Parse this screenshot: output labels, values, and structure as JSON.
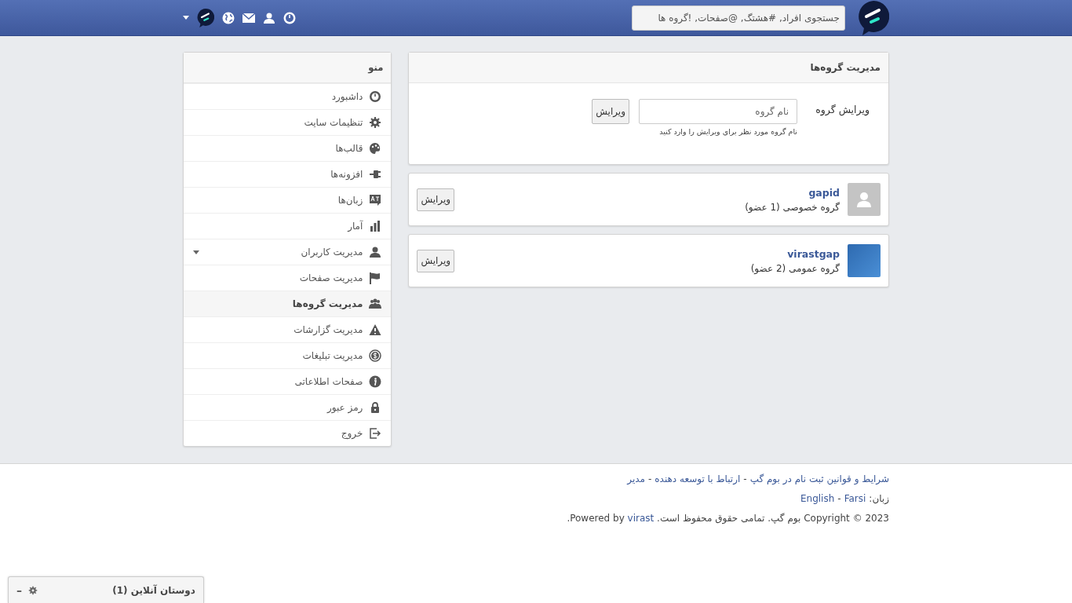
{
  "header": {
    "search": {
      "placeholder": "جستجوی افراد, #هشتگ, @صفحات, !گروه ها"
    }
  },
  "panel": {
    "title": "مدیریت گروه‌ها",
    "form": {
      "label": "ویرایش گروه",
      "placeholder": "نام گروه",
      "button": "ویرایش",
      "help": "نام گروه مورد نظر برای ویرایش را وارد کنید"
    }
  },
  "groups": [
    {
      "name": "gapid",
      "info": "گروه خصوصی (1 عضو)",
      "kind": "default-avatar",
      "button": "ویرایش"
    },
    {
      "name": "virastgap",
      "info": "گروه عمومی (2 عضو)",
      "kind": "photo",
      "button": "ویرایش"
    }
  ],
  "menu": {
    "title": "منو",
    "items": [
      {
        "label": "داشبورد",
        "kind": "link",
        "selected": false
      },
      {
        "label": "تنظیمات سایت",
        "kind": "link",
        "selected": false
      },
      {
        "label": "قالب‌ها",
        "kind": "link",
        "selected": false
      },
      {
        "label": "افزونه‌ها",
        "kind": "link",
        "selected": false
      },
      {
        "label": "زبان‌ها",
        "kind": "link",
        "selected": false
      },
      {
        "label": "آمار",
        "kind": "link",
        "selected": false
      },
      {
        "label": "مدیریت کاربران",
        "kind": "dropdown",
        "selected": false
      },
      {
        "label": "مدیریت صفحات",
        "kind": "link",
        "selected": false
      },
      {
        "label": "مدیریت گروه‌ها",
        "kind": "link",
        "selected": true
      },
      {
        "label": "مدیریت گزارشات",
        "kind": "link",
        "selected": false
      },
      {
        "label": "مدیریت تبلیغات",
        "kind": "link",
        "selected": false
      },
      {
        "label": "صفحات اطلاعاتی",
        "kind": "link",
        "selected": false
      },
      {
        "label": "رمز عبور",
        "kind": "link",
        "selected": false
      },
      {
        "label": "خروج",
        "kind": "link",
        "selected": false
      }
    ]
  },
  "footer": {
    "links": [
      "شرایط و قوانین ثبت نام در بوم گپ",
      "ارتباط با توسعه دهنده",
      "مدیر"
    ],
    "separator": "-",
    "language_label": "زبان:",
    "languages": [
      "Farsi",
      "English"
    ],
    "copyright": "2023 © Copyright بوم گپ. تمامی حقوق محفوظ است. Powered by",
    "powered_link": "virast",
    "copyright_end": "."
  },
  "chat_bar": {
    "title": "دوستان آنلاین (1)",
    "minimize": "–"
  }
}
